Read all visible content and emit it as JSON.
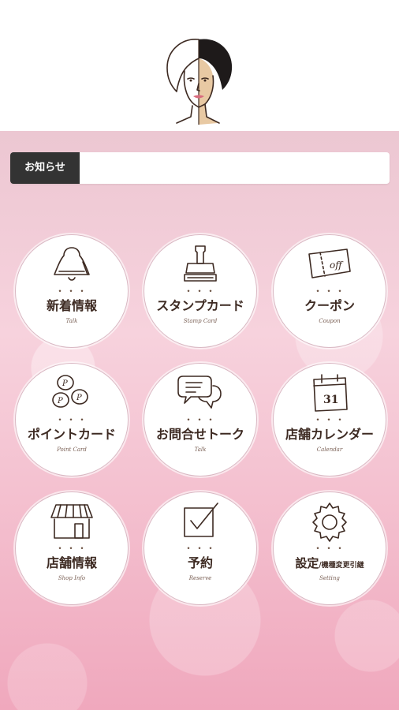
{
  "notice": {
    "label": "お知らせ",
    "text": ""
  },
  "menu": [
    {
      "label": "新着情報",
      "sub": "",
      "en": "Talk",
      "icon": "bell-icon"
    },
    {
      "label": "スタンプカード",
      "sub": "",
      "en": "Stamp Card",
      "icon": "stamp-icon"
    },
    {
      "label": "クーポン",
      "sub": "",
      "en": "Coupon",
      "icon": "coupon-ticket-icon"
    },
    {
      "label": "ポイントカード",
      "sub": "",
      "en": "Point Card",
      "icon": "coins-icon"
    },
    {
      "label": "お問合せトーク",
      "sub": "",
      "en": "Talk",
      "icon": "chat-bubbles-icon"
    },
    {
      "label": "店舗カレンダー",
      "sub": "",
      "en": "Calendar",
      "icon": "calendar-icon"
    },
    {
      "label": "店舗情報",
      "sub": "",
      "en": "Shop Info",
      "icon": "storefront-icon"
    },
    {
      "label": "予約",
      "sub": "",
      "en": "Reserve",
      "icon": "checkbox-icon"
    },
    {
      "label": "設定",
      "sub": "/機種変更引継",
      "en": "Setting",
      "icon": "gear-icon"
    }
  ],
  "calendar_day": "31",
  "coupon_text": "off",
  "coin_letter": "P",
  "dots": "・・・",
  "colors": {
    "text": "#3d2a22",
    "notice_label_bg": "#333333",
    "bg_pink": "#f3bccc"
  }
}
